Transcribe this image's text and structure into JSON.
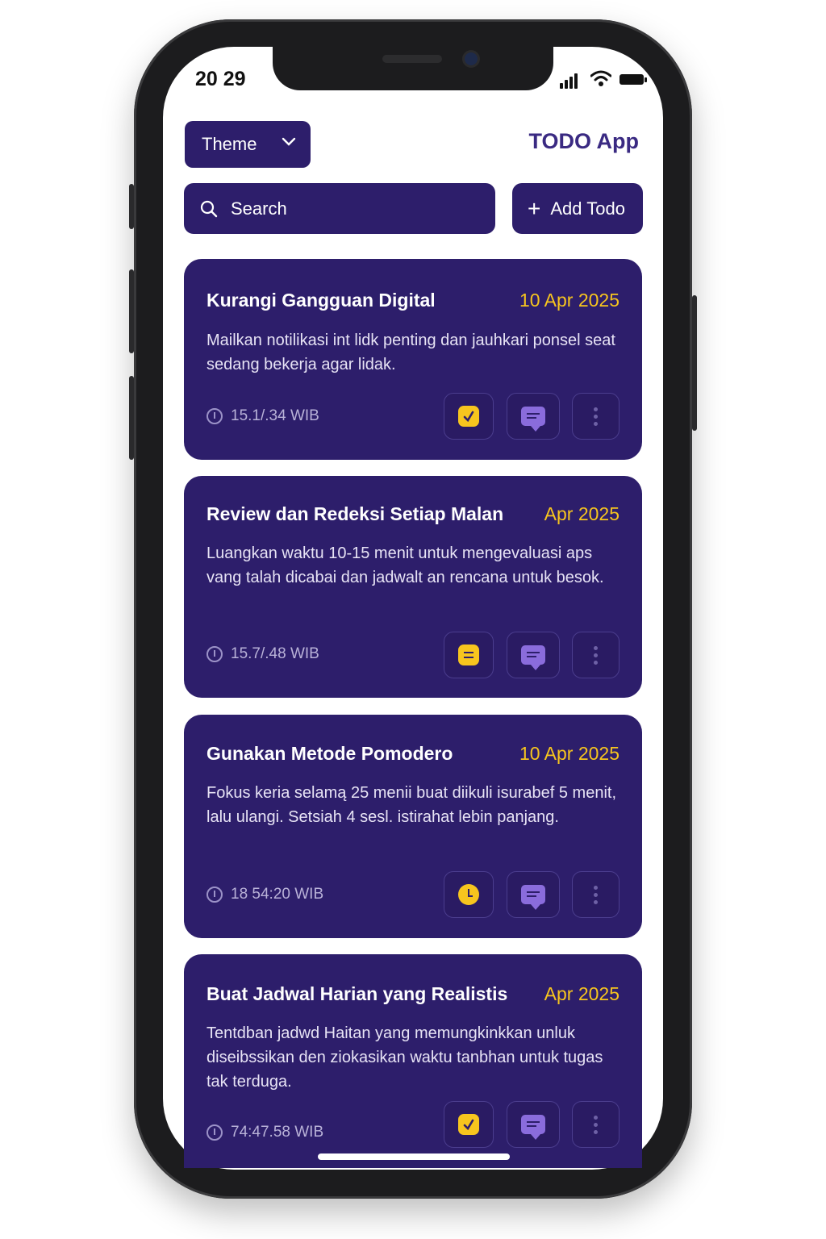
{
  "status_bar": {
    "time": "20 29"
  },
  "header": {
    "theme_label": "Theme",
    "app_title": "TODO App"
  },
  "search": {
    "placeholder": "Search"
  },
  "add_todo_label": "Add Todo",
  "todos": [
    {
      "title": "Kurangi Gangguan Digital",
      "date": "10 Apr 2025",
      "description": "Mailkan notilikasi int lidk penting dan jauhkari ponsel seat sedang bekerja agar lidak.",
      "time": "15.1/.34 WIB",
      "status_icon": "check-icon"
    },
    {
      "title": "Review dan Redeksi Setiap Malan",
      "date": "Apr 2025",
      "description": "Luangkan waktu 10-15 menit untuk mengevaluasi aps vang talah dicabai dan jadwalt an rencana untuk besok.",
      "time": "15.7/.48 WIB",
      "status_icon": "note-icon"
    },
    {
      "title": "Gunakan Metode Pomodero",
      "date": "10 Apr 2025",
      "description": "Fokus keria selamą 25 menii buat diikuli isurabef 5 menit, lalu ulangi. Setsiah 4 sesl. istirahat lebin panjang.",
      "time": "18 54:20 WIB",
      "status_icon": "clock-icon"
    },
    {
      "title": "Buat Jadwal Harian yang Realistis",
      "date": "Apr 2025",
      "description": "Tentdban jadwd Haitan yang memungkinkkan unluk diseibssikan den ziokasikan waktu tanbhan untuk tugas tak terduga.",
      "time": "74:47.58 WIB",
      "status_icon": "check-icon"
    }
  ],
  "colors": {
    "primary": "#2d1e6b",
    "accent_yellow": "#f7c51e",
    "chat_purple": "#8a6cdc",
    "title_purple": "#3a2a82"
  }
}
